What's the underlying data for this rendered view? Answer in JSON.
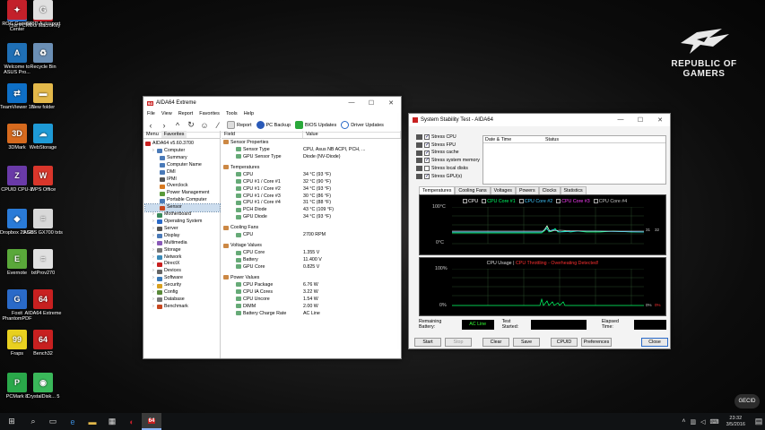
{
  "desktop": {
    "icons": [
      {
        "label": "This PC",
        "icon": "computer-icon",
        "color": "#3a7bd5",
        "glyph": "▭"
      },
      {
        "label": "ROG MacroKey",
        "icon": "rog-macrokey-icon",
        "color": "#c3202a",
        "glyph": "M"
      },
      {
        "label": "Welcome to ASUS Pro...",
        "icon": "asus-icon",
        "color": "#1f6fb5",
        "glyph": "A"
      },
      {
        "label": "Recycle Bin",
        "icon": "recycle-bin-icon",
        "color": "#6b8fb5",
        "glyph": "♻"
      },
      {
        "label": "TeamViewer 10",
        "icon": "teamviewer-icon",
        "color": "#0e6fc6",
        "glyph": "⇄"
      },
      {
        "label": "New folder",
        "icon": "folder-icon",
        "color": "#e3b84a",
        "glyph": "▬"
      },
      {
        "label": "3DMark",
        "icon": "3dmark-icon",
        "color": "#d66a1e",
        "glyph": "3D"
      },
      {
        "label": "WebStorage",
        "icon": "webstorage-icon",
        "color": "#1e9ad6",
        "glyph": "☁"
      },
      {
        "label": "CPUID CPU-Z",
        "icon": "cpuz-icon",
        "color": "#6a3aa8",
        "glyph": "Z"
      },
      {
        "label": "WPS Office",
        "icon": "wps-icon",
        "color": "#d9362b",
        "glyph": "W"
      },
      {
        "label": "Dropbox 25 GB",
        "icon": "dropbox-icon",
        "color": "#2a7bd8",
        "glyph": "◆"
      },
      {
        "label": "ASUS GX700 txts",
        "icon": "text-file-icon",
        "color": "#d8d8d8",
        "glyph": "≡"
      },
      {
        "label": "Evernote",
        "icon": "evernote-icon",
        "color": "#5aa83a",
        "glyph": "E"
      },
      {
        "label": "txtProv270",
        "icon": "text-file-icon",
        "color": "#e0e0e0",
        "glyph": "≡"
      },
      {
        "label": "Foxit PhantomPDF",
        "icon": "foxit-icon",
        "color": "#2a6ac8",
        "glyph": "G"
      },
      {
        "label": "AIDA64 Extreme",
        "icon": "aida64-icon",
        "color": "#c82020",
        "glyph": "64"
      },
      {
        "label": "Fraps",
        "icon": "fraps-icon",
        "color": "#e8d020",
        "glyph": "99"
      },
      {
        "label": "Bench32",
        "icon": "bench-icon",
        "color": "#c82020",
        "glyph": "64"
      },
      {
        "label": "PCMark 8",
        "icon": "pcmark-icon",
        "color": "#2aa84a",
        "glyph": "P"
      },
      {
        "label": "CrystalDisk... 5",
        "icon": "crystaldisk-icon",
        "color": "#3ab85a",
        "glyph": "◉"
      },
      {
        "label": "ROG Gaming Center",
        "icon": "rog-gaming-center-icon",
        "color": "#c3202a",
        "glyph": "✦"
      },
      {
        "label": "GRID Autosport",
        "icon": "grid-autosport-icon",
        "color": "#e0e0e0",
        "glyph": "G"
      }
    ],
    "rog_logo": {
      "line1": "REPUBLIC OF",
      "line2": "GAMERS"
    }
  },
  "aida": {
    "title": "AIDA64 Extreme",
    "menu": [
      "File",
      "View",
      "Report",
      "Favorites",
      "Tools",
      "Help"
    ],
    "toolbar": {
      "report": "Report",
      "backup": "PC Backup",
      "bios": "BIOS Updates",
      "driver": "Driver Updates"
    },
    "pane_tabs": [
      "Menu",
      "Favorites"
    ],
    "tree": [
      {
        "label": "AIDA64 v5.60.3700",
        "indent": 0,
        "color": "#c82020"
      },
      {
        "label": "Computer",
        "indent": 1,
        "color": "#4a7ab8"
      },
      {
        "label": "Summary",
        "indent": 2,
        "color": "#4a7ab8"
      },
      {
        "label": "Computer Name",
        "indent": 2,
        "color": "#4a7ab8"
      },
      {
        "label": "DMI",
        "indent": 2,
        "color": "#4a7ab8"
      },
      {
        "label": "IPMI",
        "indent": 2,
        "color": "#555"
      },
      {
        "label": "Overclock",
        "indent": 2,
        "color": "#d87a20"
      },
      {
        "label": "Power Management",
        "indent": 2,
        "color": "#5a9a3a"
      },
      {
        "label": "Portable Computer",
        "indent": 2,
        "color": "#4a7ab8"
      },
      {
        "label": "Sensor",
        "indent": 2,
        "color": "#c84820",
        "selected": true
      },
      {
        "label": "Motherboard",
        "indent": 1,
        "color": "#3a8a5a"
      },
      {
        "label": "Operating System",
        "indent": 1,
        "color": "#2a6ac8"
      },
      {
        "label": "Server",
        "indent": 1,
        "color": "#555"
      },
      {
        "label": "Display",
        "indent": 1,
        "color": "#4a7ab8"
      },
      {
        "label": "Multimedia",
        "indent": 1,
        "color": "#8a5ab8"
      },
      {
        "label": "Storage",
        "indent": 1,
        "color": "#777"
      },
      {
        "label": "Network",
        "indent": 1,
        "color": "#3a8ab8"
      },
      {
        "label": "DirectX",
        "indent": 1,
        "color": "#c82020"
      },
      {
        "label": "Devices",
        "indent": 1,
        "color": "#666"
      },
      {
        "label": "Software",
        "indent": 1,
        "color": "#3a7ab8"
      },
      {
        "label": "Security",
        "indent": 1,
        "color": "#d8a020"
      },
      {
        "label": "Config",
        "indent": 1,
        "color": "#5a8a3a"
      },
      {
        "label": "Database",
        "indent": 1,
        "color": "#777"
      },
      {
        "label": "Benchmark",
        "indent": 1,
        "color": "#c84820"
      }
    ],
    "columns": {
      "field": "Field",
      "value": "Value"
    },
    "rows": [
      {
        "type": "sec",
        "field": "Sensor Properties",
        "value": ""
      },
      {
        "type": "item",
        "field": "Sensor Type",
        "value": "CPU, Asus NB ACPI, PCH, ..."
      },
      {
        "type": "item",
        "field": "GPU Sensor Type",
        "value": "Diode (NV-Diode)"
      },
      {
        "type": "gap",
        "field": "",
        "value": ""
      },
      {
        "type": "sec",
        "field": "Temperatures",
        "value": ""
      },
      {
        "type": "item",
        "field": "CPU",
        "value": "34 °C (93 °F)"
      },
      {
        "type": "item",
        "field": "CPU #1 / Core #1",
        "value": "32 °C (90 °F)"
      },
      {
        "type": "item",
        "field": "CPU #1 / Core #2",
        "value": "34 °C (93 °F)"
      },
      {
        "type": "item",
        "field": "CPU #1 / Core #3",
        "value": "30 °C (86 °F)"
      },
      {
        "type": "item",
        "field": "CPU #1 / Core #4",
        "value": "31 °C (88 °F)"
      },
      {
        "type": "item",
        "field": "PCH Diode",
        "value": "43 °C (109 °F)"
      },
      {
        "type": "item",
        "field": "GPU Diode",
        "value": "34 °C (93 °F)"
      },
      {
        "type": "gap",
        "field": "",
        "value": ""
      },
      {
        "type": "sec",
        "field": "Cooling Fans",
        "value": ""
      },
      {
        "type": "item",
        "field": "CPU",
        "value": "2700 RPM"
      },
      {
        "type": "gap",
        "field": "",
        "value": ""
      },
      {
        "type": "sec",
        "field": "Voltage Values",
        "value": ""
      },
      {
        "type": "item",
        "field": "CPU Core",
        "value": "1.355 V"
      },
      {
        "type": "item",
        "field": "Battery",
        "value": "11.400 V"
      },
      {
        "type": "item",
        "field": "GPU Core",
        "value": "0.825 V"
      },
      {
        "type": "gap",
        "field": "",
        "value": ""
      },
      {
        "type": "sec",
        "field": "Power Values",
        "value": ""
      },
      {
        "type": "item",
        "field": "CPU Package",
        "value": "6.76 W"
      },
      {
        "type": "item",
        "field": "CPU IA Cores",
        "value": "3.22 W"
      },
      {
        "type": "item",
        "field": "CPU Uncore",
        "value": "1.54 W"
      },
      {
        "type": "item",
        "field": "DIMM",
        "value": "2.00 W"
      },
      {
        "type": "item",
        "field": "Battery Charge Rate",
        "value": "AC Line"
      }
    ]
  },
  "sst": {
    "title": "System Stability Test - AIDA64",
    "checks": [
      {
        "label": "Stress CPU",
        "checked": true
      },
      {
        "label": "Stress FPU",
        "checked": true
      },
      {
        "label": "Stress cache",
        "checked": true
      },
      {
        "label": "Stress system memory",
        "checked": true
      },
      {
        "label": "Stress local disks",
        "checked": false
      },
      {
        "label": "Stress GPU(s)",
        "checked": true
      }
    ],
    "log_headers": {
      "date": "Date & Time",
      "status": "Status"
    },
    "tabs": [
      "Temperatures",
      "Cooling Fans",
      "Voltages",
      "Powers",
      "Clocks",
      "Statistics"
    ],
    "temp_legend": [
      {
        "label": "CPU",
        "color": "#ffffff"
      },
      {
        "label": "CPU Core #1",
        "color": "#00ff66"
      },
      {
        "label": "CPU Core #2",
        "color": "#40c8ff"
      },
      {
        "label": "CPU Core #3",
        "color": "#ff40ff"
      },
      {
        "label": "CPU Core #4",
        "color": "#c0c0c0"
      }
    ],
    "temp_axis": {
      "top": "100°C",
      "bottom": "0°C",
      "right_a": "31",
      "right_b": "32"
    },
    "usage": {
      "title": "CPU Usage",
      "sep": "|",
      "throttle": "CPU Throttling - Overheating Detected!",
      "top": "100%",
      "bottom": "0%",
      "right_a": "0%",
      "right_b": "0%"
    },
    "info": {
      "battery_label": "Remaining Battery:",
      "battery_value": "AC Line",
      "started_label": "Test Started:",
      "elapsed_label": "Elapsed Time:"
    },
    "buttons": {
      "start": "Start",
      "stop": "Stop",
      "clear": "Clear",
      "save": "Save",
      "cpuid": "CPUID",
      "prefs": "Preferences",
      "close": "Close"
    }
  },
  "taskbar": {
    "time": "23:32",
    "date": "3/5/2016",
    "active_app": "64"
  },
  "watermark": "GECID"
}
